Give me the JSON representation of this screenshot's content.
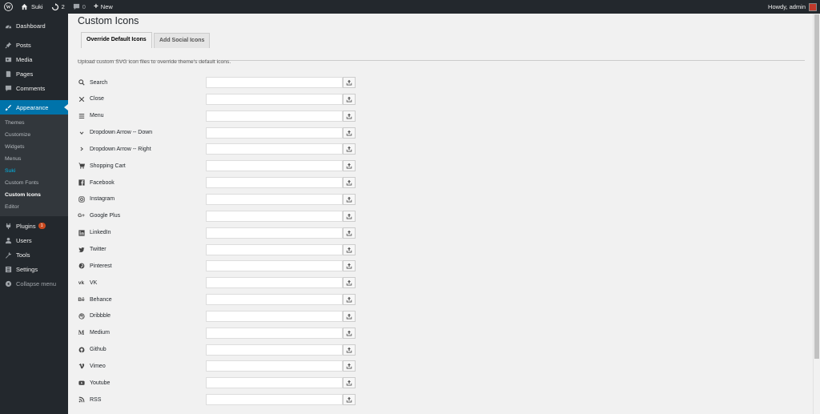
{
  "adminbar": {
    "site_name": "Suki",
    "updates_count": "2",
    "comments_count": "0",
    "new_label": "New",
    "howdy": "Howdy, admin"
  },
  "sidebar": {
    "items_top": [
      {
        "label": "Dashboard",
        "icon": "dashboard-icon"
      },
      {
        "label": "Posts",
        "icon": "pin-icon"
      },
      {
        "label": "Media",
        "icon": "media-icon"
      },
      {
        "label": "Pages",
        "icon": "page-icon"
      },
      {
        "label": "Comments",
        "icon": "comment-icon"
      },
      {
        "label": "Appearance",
        "icon": "brush-icon"
      }
    ],
    "submenu": [
      "Themes",
      "Customize",
      "Widgets",
      "Menus",
      "Suki",
      "Custom Fonts",
      "Custom Icons",
      "Editor"
    ],
    "items_bottom": [
      {
        "label": "Plugins",
        "icon": "plugin-icon",
        "badge": "1"
      },
      {
        "label": "Users",
        "icon": "users-icon"
      },
      {
        "label": "Tools",
        "icon": "wrench-icon"
      },
      {
        "label": "Settings",
        "icon": "settings-icon"
      },
      {
        "label": "Collapse menu",
        "icon": "collapse-icon"
      }
    ]
  },
  "main": {
    "title": "Custom Icons",
    "tabs": [
      "Override Default Icons",
      "Add Social Icons"
    ],
    "description": "Upload custom SVG icon files to override theme's default icons.",
    "icons": [
      {
        "label": "Search",
        "icon": "search-icon"
      },
      {
        "label": "Close",
        "icon": "close-icon"
      },
      {
        "label": "Menu",
        "icon": "menu-icon"
      },
      {
        "label": "Dropdown Arrow -- Down",
        "icon": "chevron-down-icon"
      },
      {
        "label": "Dropdown Arrow -- Right",
        "icon": "chevron-right-icon"
      },
      {
        "label": "Shopping Cart",
        "icon": "cart-icon"
      },
      {
        "label": "Facebook",
        "icon": "facebook-icon"
      },
      {
        "label": "Instagram",
        "icon": "instagram-icon"
      },
      {
        "label": "Google Plus",
        "icon": "google-plus-icon"
      },
      {
        "label": "LinkedIn",
        "icon": "linkedin-icon"
      },
      {
        "label": "Twitter",
        "icon": "twitter-icon"
      },
      {
        "label": "Pinterest",
        "icon": "pinterest-icon"
      },
      {
        "label": "VK",
        "icon": "vk-icon"
      },
      {
        "label": "Behance",
        "icon": "behance-icon"
      },
      {
        "label": "Dribbble",
        "icon": "dribbble-icon"
      },
      {
        "label": "Medium",
        "icon": "medium-icon"
      },
      {
        "label": "Github",
        "icon": "github-icon"
      },
      {
        "label": "Vimeo",
        "icon": "vimeo-icon"
      },
      {
        "label": "Youtube",
        "icon": "youtube-icon"
      },
      {
        "label": "RSS",
        "icon": "rss-icon"
      }
    ]
  },
  "colors": {
    "admin_dark": "#23282d",
    "accent_blue": "#0073aa",
    "submenu_current": "#00b9eb",
    "badge": "#ca4a1f"
  }
}
